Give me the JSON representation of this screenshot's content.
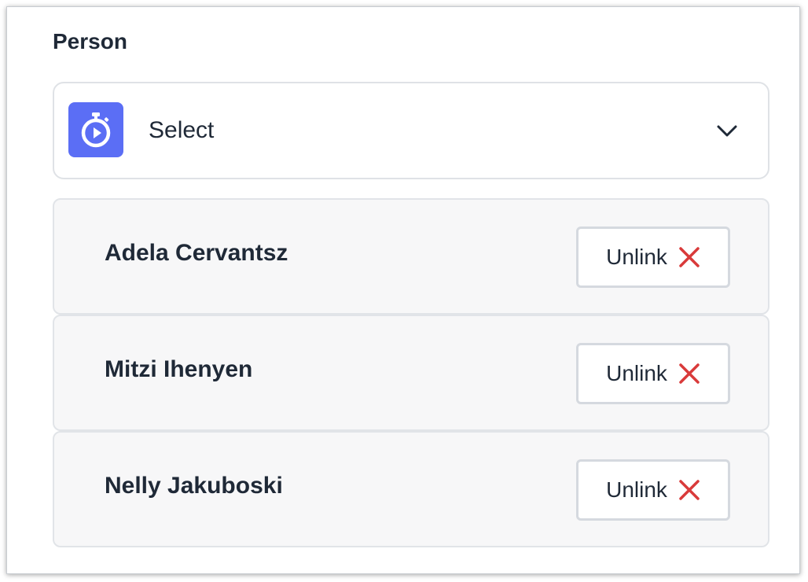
{
  "section": {
    "title": "Person"
  },
  "select": {
    "label": "Select",
    "icon": "stopwatch-icon",
    "icon_color": "#5b6ef5"
  },
  "linked_people": [
    {
      "name": "Adela Cervantsz",
      "action_label": "Unlink"
    },
    {
      "name": "Mitzi Ihenyen",
      "action_label": "Unlink"
    },
    {
      "name": "Nelly Jakuboski",
      "action_label": "Unlink"
    }
  ],
  "colors": {
    "unlink_x": "#d93a3a",
    "text": "#1f2937"
  }
}
